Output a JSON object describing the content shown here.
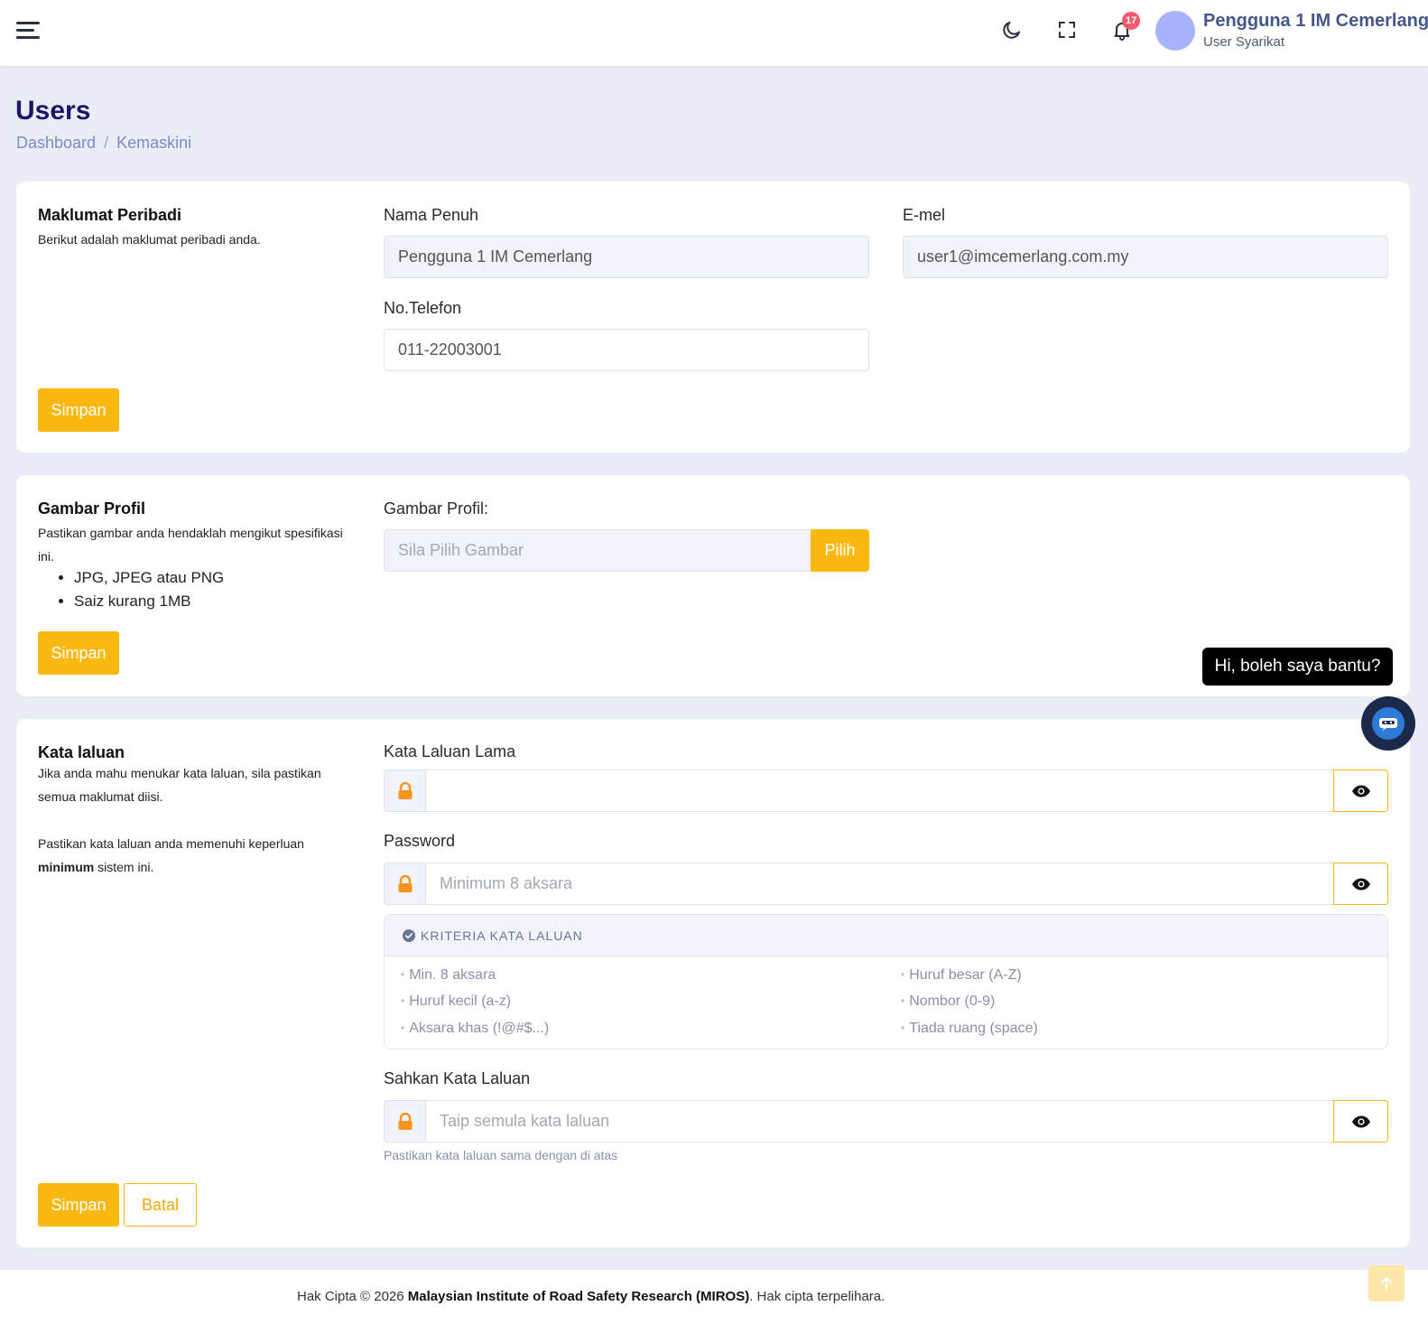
{
  "header": {
    "notification_count": "17",
    "user_name": "Pengguna 1 IM Cemerlang",
    "user_role": "User Syarikat"
  },
  "page": {
    "title": "Users",
    "breadcrumb": {
      "home": "Dashboard",
      "current": "Kemaskini"
    }
  },
  "personal": {
    "title": "Maklumat Peribadi",
    "desc": "Berikut adalah maklumat peribadi anda.",
    "name_label": "Nama Penuh",
    "name_value": "Pengguna 1 IM Cemerlang",
    "email_label": "E-mel",
    "email_value": "user1@imcemerlang.com.my",
    "phone_label": "No.Telefon",
    "phone_value": "011-22003001",
    "save_label": "Simpan"
  },
  "profile_image": {
    "title": "Gambar Profil",
    "desc": "Pastikan gambar anda hendaklah mengikut spesifikasi ini.",
    "specs": [
      "JPG, JPEG atau PNG",
      "Saiz kurang 1MB"
    ],
    "field_label": "Gambar Profil:",
    "placeholder": "Sila Pilih Gambar",
    "choose_label": "Pilih",
    "save_label": "Simpan"
  },
  "password": {
    "title": "Kata laluan",
    "desc1": "Jika anda mahu menukar kata laluan, sila pastikan semua maklumat diisi.",
    "desc2_pre": "Pastikan kata laluan anda memenuhi keperluan ",
    "desc2_bold": "minimum",
    "desc2_post": " sistem ini.",
    "old_label": "Kata Laluan Lama",
    "old_placeholder": "",
    "new_label": "Password",
    "new_placeholder": "Minimum 8 aksara",
    "criteria_title": "KRITERIA KATA LALUAN",
    "criteria": {
      "min_length": "Min. 8 aksara",
      "uppercase": "Huruf besar (A-Z)",
      "lowercase": "Huruf kecil (a-z)",
      "number": "Nombor (0-9)",
      "special": "Aksara khas (!@#$...)",
      "no_space": "Tiada ruang (space)"
    },
    "confirm_label": "Sahkan Kata Laluan",
    "confirm_placeholder": "Taip semula kata laluan",
    "confirm_help": "Pastikan kata laluan sama dengan di atas",
    "save_label": "Simpan",
    "cancel_label": "Batal"
  },
  "chat": {
    "bubble": "Hi, boleh saya bantu?"
  },
  "footer": {
    "prefix": "Hak Cipta © 2026 ",
    "org": "Malaysian Institute of Road Safety Research (MIROS)",
    "suffix": ". Hak cipta terpelihara."
  },
  "colors": {
    "accent": "#fbb810",
    "title": "#1c1668",
    "background": "#ebedf6"
  }
}
